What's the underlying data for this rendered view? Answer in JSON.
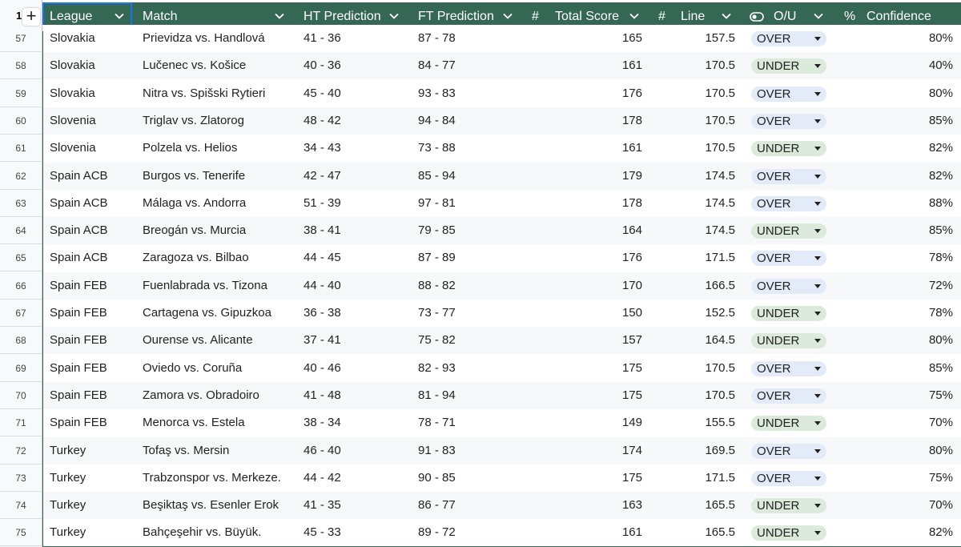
{
  "header": {
    "corner_row": "1",
    "columns": [
      {
        "label": "League",
        "icon": "",
        "chev": true
      },
      {
        "label": "Match",
        "icon": "",
        "chev": true
      },
      {
        "label": "HT Prediction",
        "icon": "",
        "chev": true
      },
      {
        "label": "FT Prediction",
        "icon": "",
        "chev": true
      },
      {
        "label": "Total Score",
        "icon": "#",
        "chev": true
      },
      {
        "label": "Line",
        "icon": "#",
        "chev": true
      },
      {
        "label": "O/U",
        "icon": "toggle-icon",
        "chev": true
      },
      {
        "label": "Confidence",
        "icon": "%",
        "chev": false
      }
    ]
  },
  "colors": {
    "header_bg": "#356854",
    "over_chip": "#e3ebf9",
    "under_chip": "#dbeadb",
    "selection": "#1a73e8"
  },
  "rows": [
    {
      "n": "57",
      "league": "Slovakia",
      "match": "Prievidza vs. Handlová",
      "ht": "41 - 36",
      "ft": "87 - 78",
      "total": "165",
      "line": "157.5",
      "ou": "OVER",
      "conf": "80%"
    },
    {
      "n": "58",
      "league": "Slovakia",
      "match": "Lučenec vs. Košice",
      "ht": "40 - 36",
      "ft": "84 - 77",
      "total": "161",
      "line": "170.5",
      "ou": "UNDER",
      "conf": "40%"
    },
    {
      "n": "59",
      "league": "Slovakia",
      "match": "Nitra vs. Spišski Rytieri",
      "ht": "45 - 40",
      "ft": "93 - 83",
      "total": "176",
      "line": "170.5",
      "ou": "OVER",
      "conf": "80%"
    },
    {
      "n": "60",
      "league": "Slovenia",
      "match": "Triglav vs. Zlatorog",
      "ht": "48 - 42",
      "ft": "94 - 84",
      "total": "178",
      "line": "170.5",
      "ou": "OVER",
      "conf": "85%"
    },
    {
      "n": "61",
      "league": "Slovenia",
      "match": "Polzela vs. Helios",
      "ht": "34 - 43",
      "ft": "73 - 88",
      "total": "161",
      "line": "170.5",
      "ou": "UNDER",
      "conf": "82%"
    },
    {
      "n": "62",
      "league": "Spain ACB",
      "match": "Burgos vs. Tenerife",
      "ht": "42 - 47",
      "ft": "85 - 94",
      "total": "179",
      "line": "174.5",
      "ou": "OVER",
      "conf": "82%"
    },
    {
      "n": "63",
      "league": "Spain ACB",
      "match": "Málaga vs. Andorra",
      "ht": "51 - 39",
      "ft": "97 - 81",
      "total": "178",
      "line": "174.5",
      "ou": "OVER",
      "conf": "88%"
    },
    {
      "n": "64",
      "league": "Spain ACB",
      "match": "Breogán vs. Murcia",
      "ht": "38 - 41",
      "ft": "79 - 85",
      "total": "164",
      "line": "174.5",
      "ou": "UNDER",
      "conf": "85%"
    },
    {
      "n": "65",
      "league": "Spain ACB",
      "match": "Zaragoza vs. Bilbao",
      "ht": "44 - 45",
      "ft": "87 - 89",
      "total": "176",
      "line": "171.5",
      "ou": "OVER",
      "conf": "78%"
    },
    {
      "n": "66",
      "league": "Spain FEB",
      "match": "Fuenlabrada vs. Tizona",
      "ht": "44 - 40",
      "ft": "88 - 82",
      "total": "170",
      "line": "166.5",
      "ou": "OVER",
      "conf": "72%"
    },
    {
      "n": "67",
      "league": "Spain FEB",
      "match": "Cartagena vs. Gipuzkoa",
      "ht": "36 - 38",
      "ft": "73 - 77",
      "total": "150",
      "line": "152.5",
      "ou": "UNDER",
      "conf": "78%"
    },
    {
      "n": "68",
      "league": "Spain FEB",
      "match": "Ourense vs. Alicante",
      "ht": "37 - 41",
      "ft": "75 - 82",
      "total": "157",
      "line": "164.5",
      "ou": "UNDER",
      "conf": "80%"
    },
    {
      "n": "69",
      "league": "Spain FEB",
      "match": "Oviedo vs. Coruña",
      "ht": "40 - 46",
      "ft": "82 - 93",
      "total": "175",
      "line": "170.5",
      "ou": "OVER",
      "conf": "85%"
    },
    {
      "n": "70",
      "league": "Spain FEB",
      "match": "Zamora vs. Obradoiro",
      "ht": "41 - 48",
      "ft": "81 - 94",
      "total": "175",
      "line": "170.5",
      "ou": "OVER",
      "conf": "75%"
    },
    {
      "n": "71",
      "league": "Spain FEB",
      "match": "Menorca vs. Estela",
      "ht": "38 - 34",
      "ft": "78 - 71",
      "total": "149",
      "line": "155.5",
      "ou": "UNDER",
      "conf": "70%"
    },
    {
      "n": "72",
      "league": "Turkey",
      "match": "Tofaş vs. Mersin",
      "ht": "46 - 40",
      "ft": "91 - 83",
      "total": "174",
      "line": "169.5",
      "ou": "OVER",
      "conf": "80%"
    },
    {
      "n": "73",
      "league": "Turkey",
      "match": "Trabzonspor vs. Merkeze.",
      "ht": "44 - 42",
      "ft": "90 - 85",
      "total": "175",
      "line": "171.5",
      "ou": "OVER",
      "conf": "75%"
    },
    {
      "n": "74",
      "league": "Turkey",
      "match": "Beşiktaş vs. Esenler Erok",
      "ht": "41 - 35",
      "ft": "86 - 77",
      "total": "163",
      "line": "165.5",
      "ou": "UNDER",
      "conf": "70%"
    },
    {
      "n": "75",
      "league": "Turkey",
      "match": "Bahçeşehir vs. Büyük.",
      "ht": "45 - 33",
      "ft": "89 - 72",
      "total": "161",
      "line": "165.5",
      "ou": "UNDER",
      "conf": "82%"
    }
  ]
}
